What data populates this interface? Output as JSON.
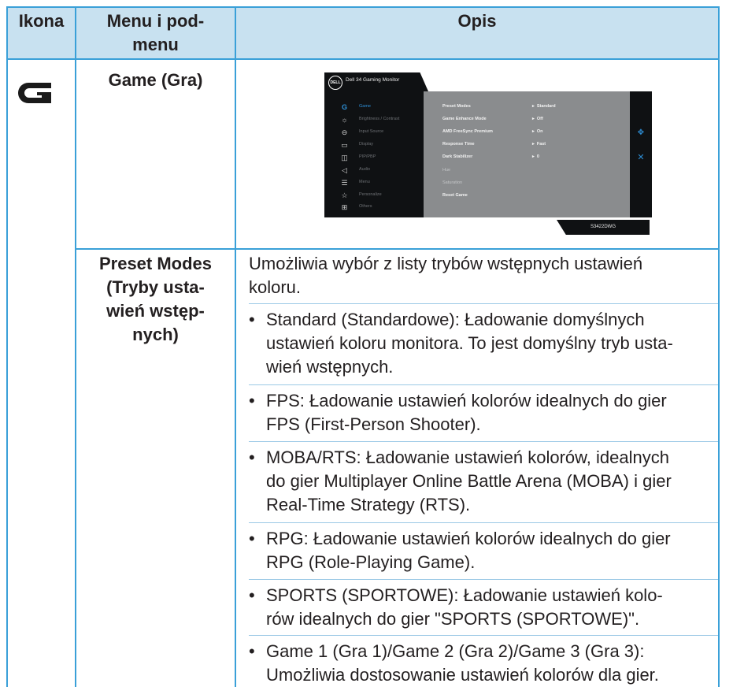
{
  "header": {
    "icon_col": "Ikona",
    "menu_col": "Menu i pod-\nmenu",
    "desc_col": "Opis"
  },
  "rows": {
    "game": {
      "icon": "game-g-icon",
      "menu": "Game (Gra)"
    },
    "preset": {
      "menu": "Preset Modes\n(Tryby usta-\nwień wstęp-\nnych)",
      "intro": "Umożliwia wybór z listy trybów wstępnych ustawień\nkoloru.",
      "bullets": [
        {
          "bold": "Standard (Standardowe):",
          "text": " Ładowanie domyślnych\nustawień koloru monitora. To jest domyślny tryb usta-\nwień wstępnych."
        },
        {
          "bold": "FPS:",
          "text": " Ładowanie ustawień kolorów idealnych do gier\nFPS (First-Person Shooter)."
        },
        {
          "bold": "MOBA/RTS:",
          "text": " Ładowanie ustawień kolorów, idealnych\ndo gier Multiplayer Online Battle Arena (MOBA) i gier\nReal-Time Strategy (RTS)."
        },
        {
          "bold": "RPG:",
          "text": " Ładowanie ustawień kolorów idealnych do gier\nRPG (Role-Playing Game)."
        },
        {
          "bold": "SPORTS (SPORTOWE):",
          "text": " Ładowanie ustawień kolo-\nrów idealnych do gier \"SPORTS (SPORTOWE)\"."
        },
        {
          "bold": "Game 1 (Gra 1)/Game 2 (Gra 2)/Game 3 (Gra 3):",
          "text": "\nUmożliwia dostosowanie ustawień kolorów dla gier."
        }
      ]
    }
  },
  "osd": {
    "logo": "DELL",
    "title": "Dell 34 Gaming Monitor",
    "model": "S3422DWG",
    "menu": [
      {
        "icon": "game-icon",
        "label": "Game",
        "active": true
      },
      {
        "icon": "brightness-icon",
        "label": "Brightness / Contrast"
      },
      {
        "icon": "input-source-icon",
        "label": "Input Source"
      },
      {
        "icon": "display-icon",
        "label": "Display"
      },
      {
        "icon": "pip-pbp-icon",
        "label": "PIP/PBP"
      },
      {
        "icon": "audio-icon",
        "label": "Audio"
      },
      {
        "icon": "menu-icon",
        "label": "Menu"
      },
      {
        "icon": "star-icon",
        "label": "Personalize"
      },
      {
        "icon": "others-icon",
        "label": "Others"
      }
    ],
    "options": [
      {
        "label": "Preset Modes",
        "value": "Standard"
      },
      {
        "label": "Game Enhance Mode",
        "value": "Off"
      },
      {
        "label": "AMD FreeSync Premium",
        "value": "On"
      },
      {
        "label": "Response Time",
        "value": "Fast"
      },
      {
        "label": "Dark Stabilizer",
        "value": "0"
      },
      {
        "label": "Hue",
        "value": "",
        "dim": true
      },
      {
        "label": "Saturation",
        "value": "",
        "dim": true
      },
      {
        "label": "Reset Game",
        "value": ""
      }
    ]
  },
  "colors": {
    "rule": "#3aa0d8",
    "header_bg": "#c8e1f0",
    "osd_dark": "#0f1113",
    "osd_panel": "#8a8c8e",
    "osd_accent": "#2e8fd6"
  }
}
